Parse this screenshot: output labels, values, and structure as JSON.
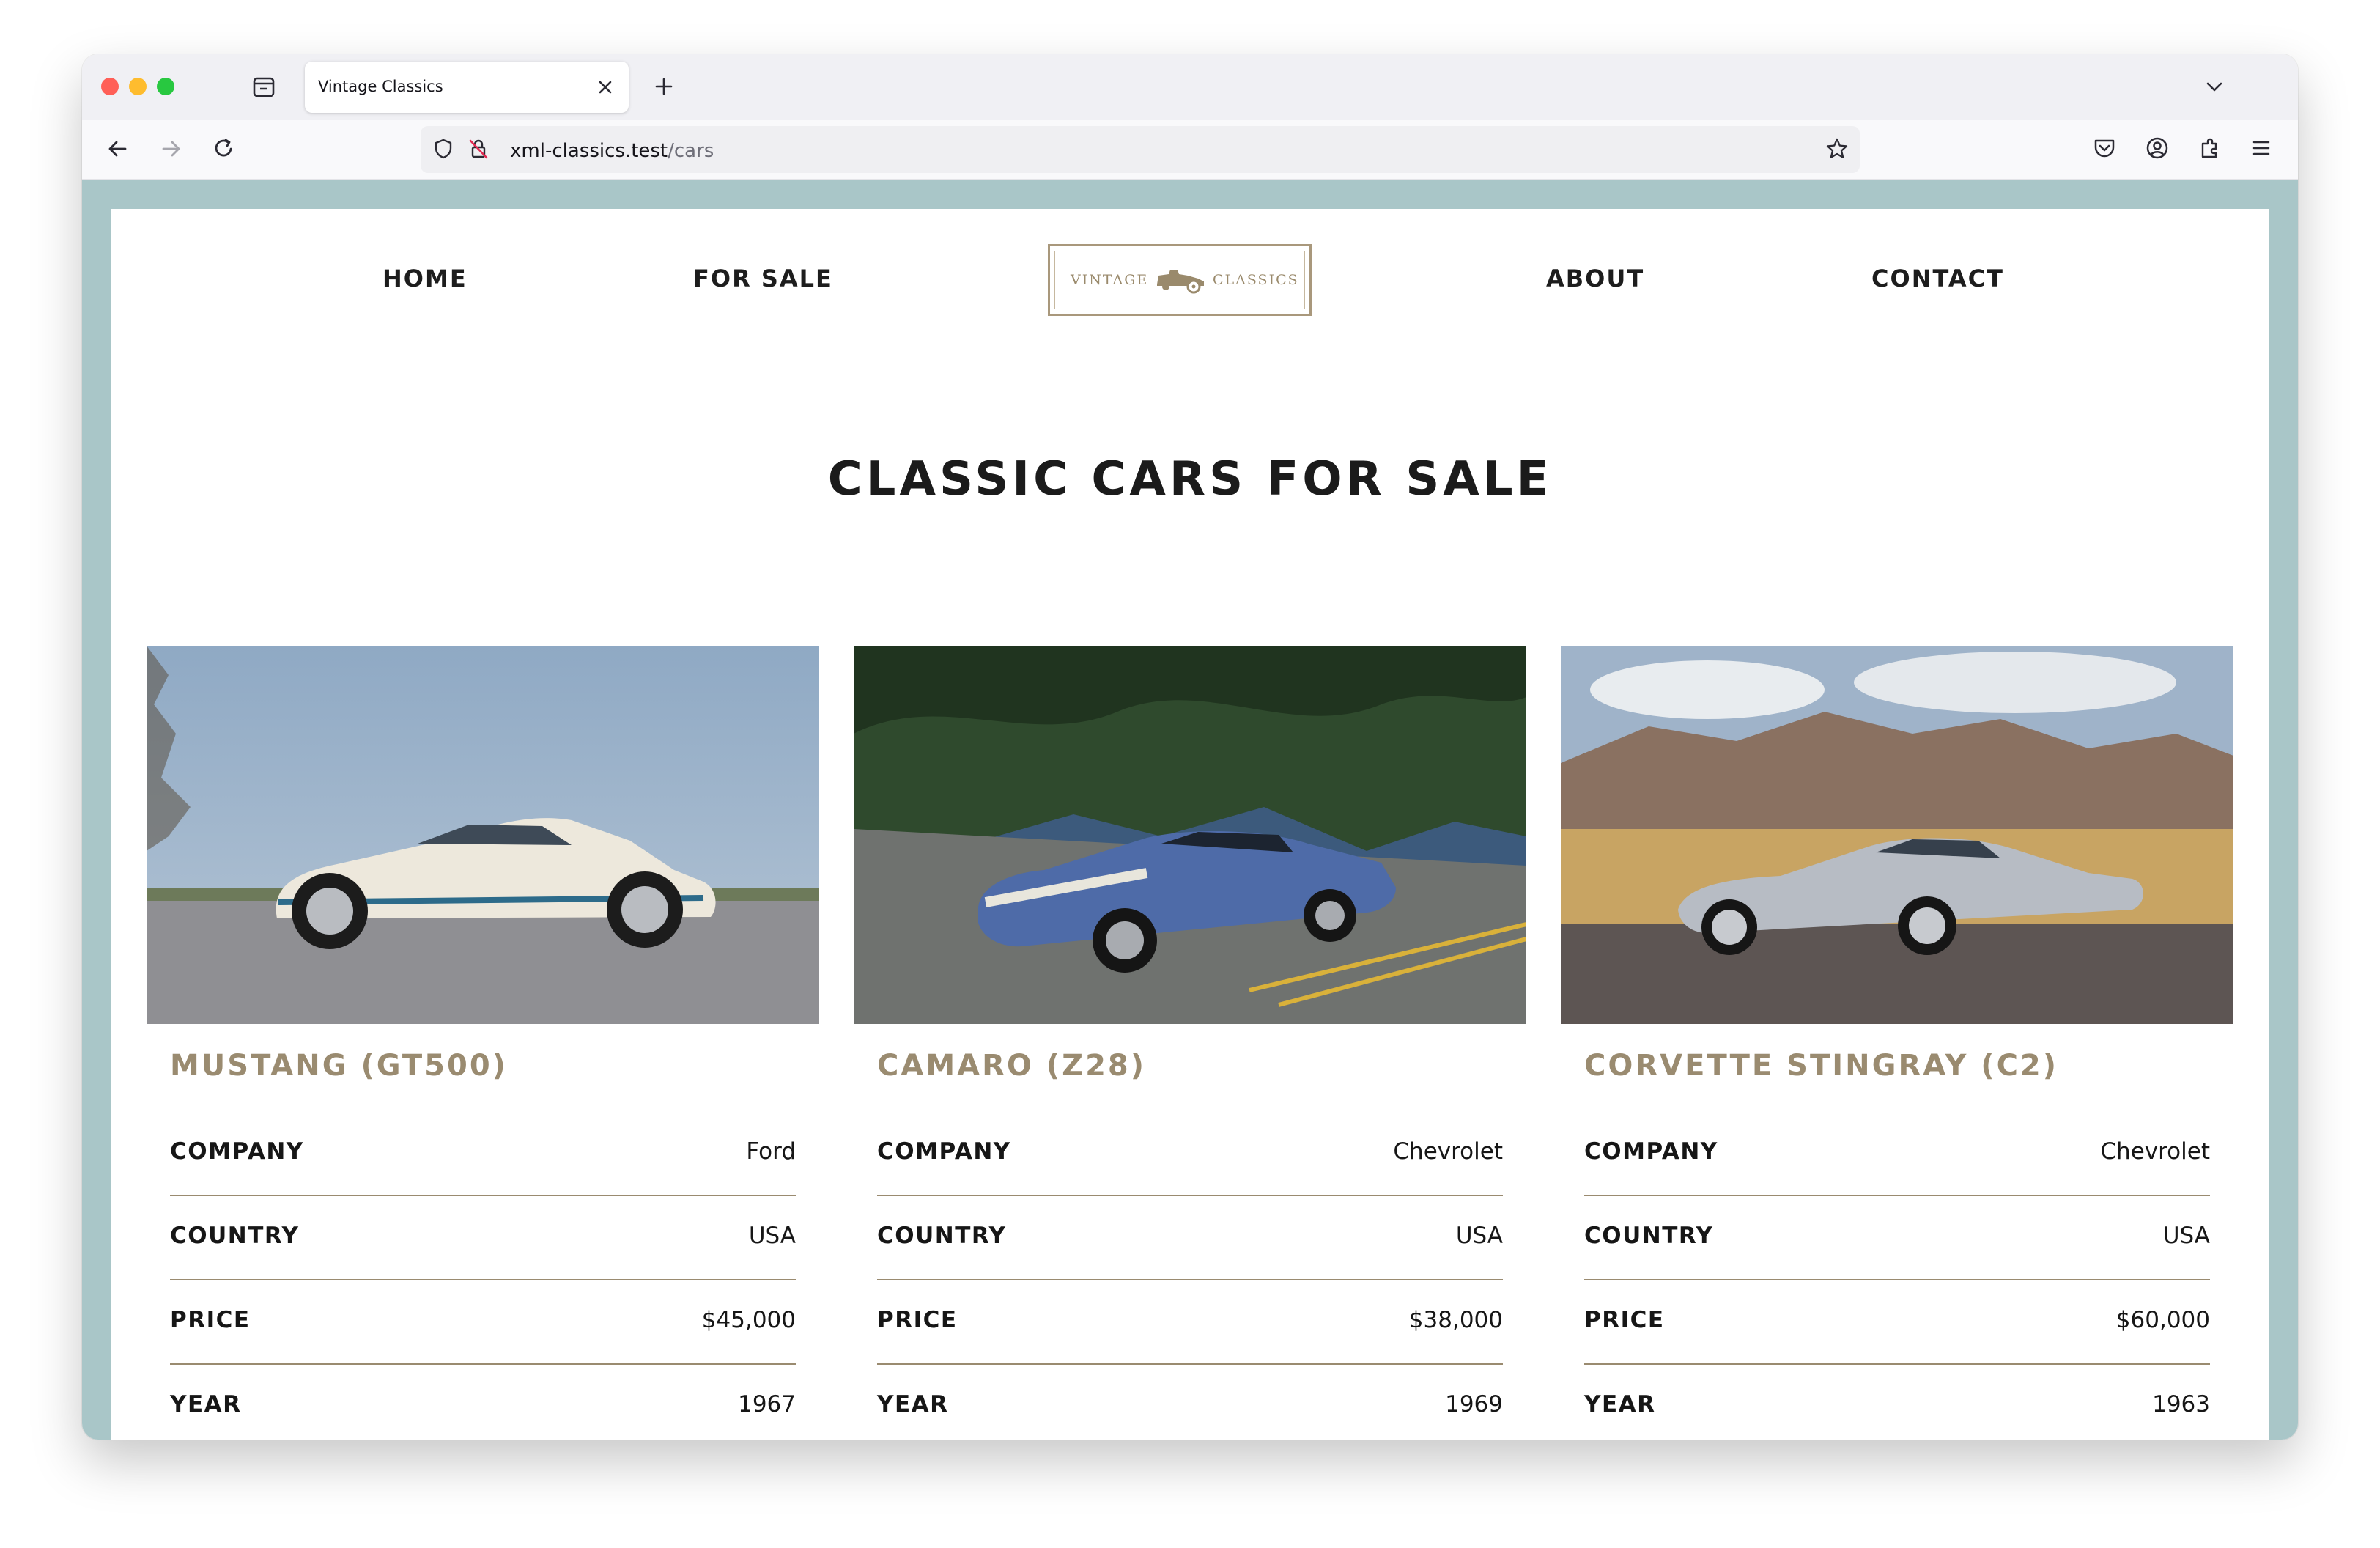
{
  "browser": {
    "tab_title": "Vintage Classics",
    "url_host": "xml-classics.test",
    "url_path": "/cars"
  },
  "site": {
    "nav": {
      "home": "HOME",
      "for_sale": "FOR SALE",
      "about": "ABOUT",
      "contact": "CONTACT"
    },
    "logo": {
      "left": "VINTAGE",
      "right": "CLASSICS"
    },
    "page_title": "CLASSIC CARS FOR SALE",
    "spec_labels": {
      "company": "COMPANY",
      "country": "COUNTRY",
      "price": "PRICE",
      "year": "YEAR"
    },
    "cars": [
      {
        "name": "MUSTANG (GT500)",
        "company": "Ford",
        "country": "USA",
        "price": "$45,000",
        "year": "1967"
      },
      {
        "name": "CAMARO (Z28)",
        "company": "Chevrolet",
        "country": "USA",
        "price": "$38,000",
        "year": "1969"
      },
      {
        "name": "CORVETTE STINGRAY (C2)",
        "company": "Chevrolet",
        "country": "USA",
        "price": "$60,000",
        "year": "1963"
      }
    ]
  },
  "colors": {
    "accent_gold": "#9a8b70",
    "page_frame": "#a9c6c8"
  }
}
